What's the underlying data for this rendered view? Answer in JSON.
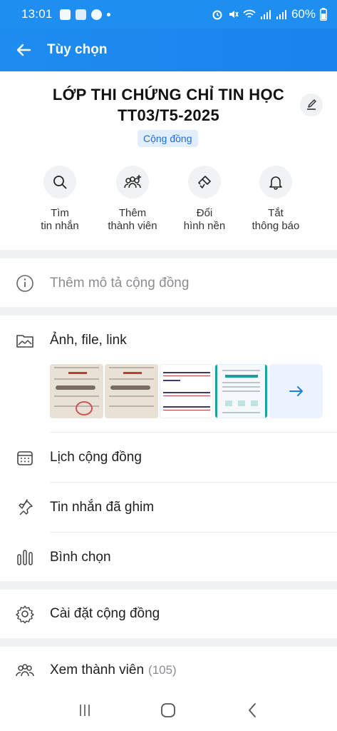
{
  "status_bar": {
    "time": "13:01",
    "battery": "60%"
  },
  "app_bar": {
    "title": "Tùy chọn"
  },
  "group": {
    "name_line1": "LỚP THI CHỨNG CHỈ TIN HỌC",
    "name_line2": "TT03/T5-2025",
    "type_badge": "Cộng đồng"
  },
  "actions": [
    {
      "line1": "Tìm",
      "line2": "tin nhắn",
      "icon": "search-icon"
    },
    {
      "line1": "Thêm",
      "line2": "thành viên",
      "icon": "add-member-icon"
    },
    {
      "line1": "Đổi",
      "line2": "hình nền",
      "icon": "brush-icon"
    },
    {
      "line1": "Tắt",
      "line2": "thông báo",
      "icon": "bell-icon"
    }
  ],
  "description_row": {
    "label": "Thêm mô tả cộng đồng",
    "icon": "info-icon"
  },
  "media_row": {
    "label": "Ảnh, file, link",
    "icon": "photo-folder-icon",
    "thumbnails": [
      {
        "kind": "certificate-photo",
        "text_top": "CHỨNG CHỈ",
        "name": "Huỳnh Phương"
      },
      {
        "kind": "certificate-photo",
        "text_top": "CHỨNG CHỈ",
        "name": "Nguyễn Văn Đ"
      },
      {
        "kind": "text-screenshot",
        "line1": "Đáo Gọi Điện Chuyển K",
        "line2": "Nhiều",
        "line3": "ời không chuyển khoản",
        "line4": "n tay mới chuyển khoả"
      },
      {
        "kind": "bank-transfer-screenshot",
        "amount": "750,000 VND"
      }
    ]
  },
  "menu": [
    {
      "label": "Lịch cộng đồng",
      "icon": "calendar-icon"
    },
    {
      "label": "Tin nhắn đã ghim",
      "icon": "pin-icon"
    },
    {
      "label": "Bình chọn",
      "icon": "poll-icon"
    }
  ],
  "settings_row": {
    "label": "Cài đặt cộng đồng",
    "icon": "gear-icon"
  },
  "members_row": {
    "label": "Xem thành viên",
    "count": "(105)",
    "icon": "members-icon"
  },
  "accent_color": "#1f8ef1"
}
